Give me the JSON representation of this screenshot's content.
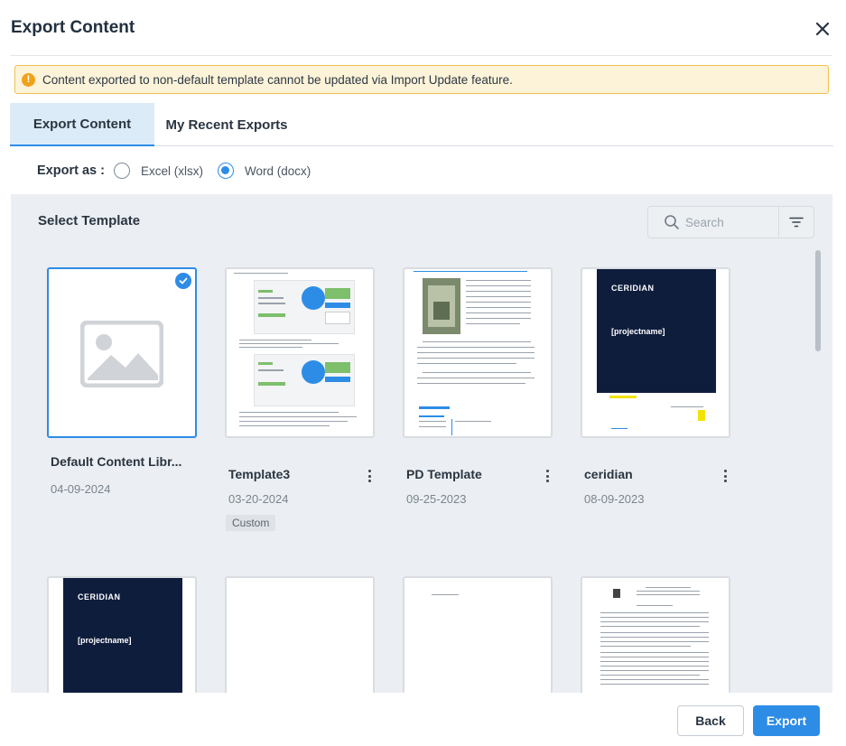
{
  "dialog": {
    "title": "Export Content",
    "close_icon": "close-icon"
  },
  "warning": {
    "icon": "info-icon",
    "text": "Content exported to non-default template cannot be updated via Import Update feature."
  },
  "tabs": [
    {
      "label": "Export Content",
      "active": true
    },
    {
      "label": "My Recent Exports",
      "active": false
    }
  ],
  "export_as": {
    "label": "Export as :",
    "options": [
      {
        "label": "Excel (xlsx)",
        "selected": false
      },
      {
        "label": "Word (docx)",
        "selected": true
      }
    ]
  },
  "template_panel": {
    "title": "Select Template",
    "search_placeholder": "Search",
    "filter_icon": "filter-icon",
    "templates": [
      {
        "name": "Default Content Libr...",
        "date": "04-09-2024",
        "selected": true,
        "thumbnail": "image-placeholder-icon"
      },
      {
        "name": "Template3",
        "date": "03-20-2024",
        "badge": "Custom",
        "thumbnail": "document-preview"
      },
      {
        "name": "PD Template",
        "date": "09-25-2023",
        "thumbnail": "document-preview"
      },
      {
        "name": "ceridian",
        "date": "08-09-2023",
        "thumbnail": "document-preview"
      }
    ],
    "thumb_text": {
      "brand": "CERIDIAN",
      "project": "[projectname]"
    }
  },
  "footer": {
    "back_label": "Back",
    "export_label": "Export"
  },
  "colors": {
    "accent": "#2d8ce6",
    "warning_bg": "#fdf3d8",
    "warning_border": "#f0c14f",
    "panel_bg": "#ebeef2",
    "navy": "#0f1d3d"
  }
}
